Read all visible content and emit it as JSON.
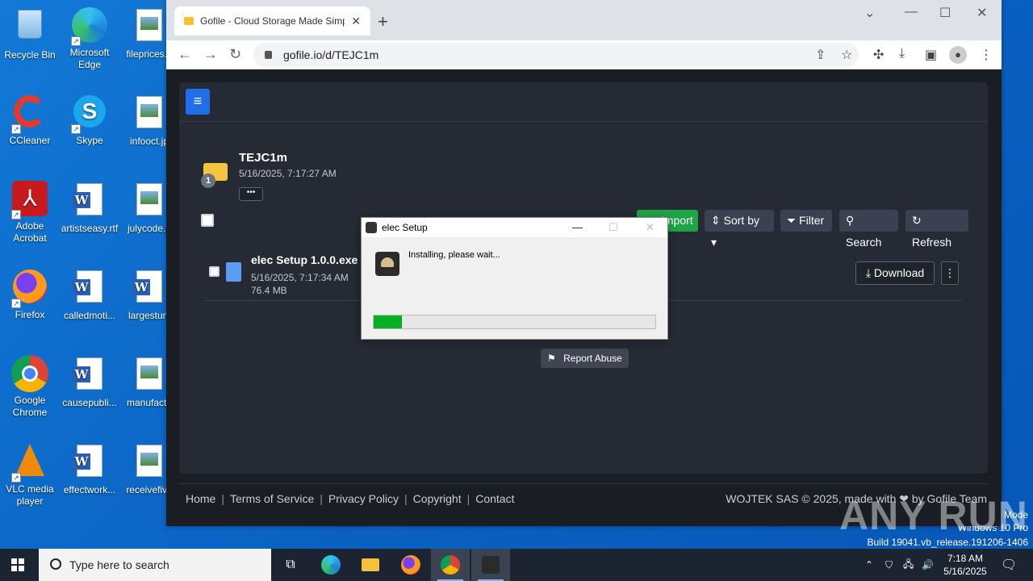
{
  "desktop": {
    "icons": [
      {
        "label": "Recycle Bin"
      },
      {
        "label": "Microsoft Edge"
      },
      {
        "label": "fileprices.p"
      },
      {
        "label": "CCleaner"
      },
      {
        "label": "Skype"
      },
      {
        "label": "infooct.jp"
      },
      {
        "label": "Adobe Acrobat"
      },
      {
        "label": "artistseasy.rtf"
      },
      {
        "label": "julycode.p"
      },
      {
        "label": "Firefox"
      },
      {
        "label": "calledmoti..."
      },
      {
        "label": "largestunl"
      },
      {
        "label": "Google Chrome"
      },
      {
        "label": "causepubli..."
      },
      {
        "label": "manufactu"
      },
      {
        "label": "VLC media player"
      },
      {
        "label": "effectwork..."
      },
      {
        "label": "receivefive"
      }
    ]
  },
  "browser": {
    "tab_title": "Gofile - Cloud Storage Made Simple",
    "url": "gofile.io/d/TEJC1m"
  },
  "page": {
    "folder_name": "TEJC1m",
    "folder_date": "5/16/2025, 7:17:27 AM",
    "folder_count": "1",
    "more_label": "•••",
    "buttons": {
      "import": "Import",
      "sort": "Sort by",
      "filter": "Filter",
      "search": "Search",
      "refresh": "Refresh"
    },
    "file": {
      "name": "elec Setup 1.0.0.exe",
      "date": "5/16/2025, 7:17:34 AM",
      "size": "76.4 MB",
      "download": "Download"
    },
    "report_abuse": "Report Abuse",
    "footer": {
      "links": [
        "Home",
        "Terms of Service",
        "Privacy Policy",
        "Copyright",
        "Contact"
      ],
      "copyright": "WOJTEK SAS © 2025, made with ❤ by Gofile Team"
    }
  },
  "dialog": {
    "title": "elec Setup",
    "message": "Installing, please wait...",
    "progress_percent": 10
  },
  "taskbar": {
    "search_placeholder": "Type here to search",
    "time": "7:18 AM",
    "date": "5/16/2025"
  },
  "watermark": {
    "text": "ANY RUN",
    "mode_line": "Test Mode",
    "os_line": "Windows 10 Pro",
    "build_line": "Build 19041.vb_release.191206-1406"
  },
  "colors": {
    "accent": "#1f6feb",
    "progress": "#06b025",
    "import_button": "#1ea446"
  }
}
